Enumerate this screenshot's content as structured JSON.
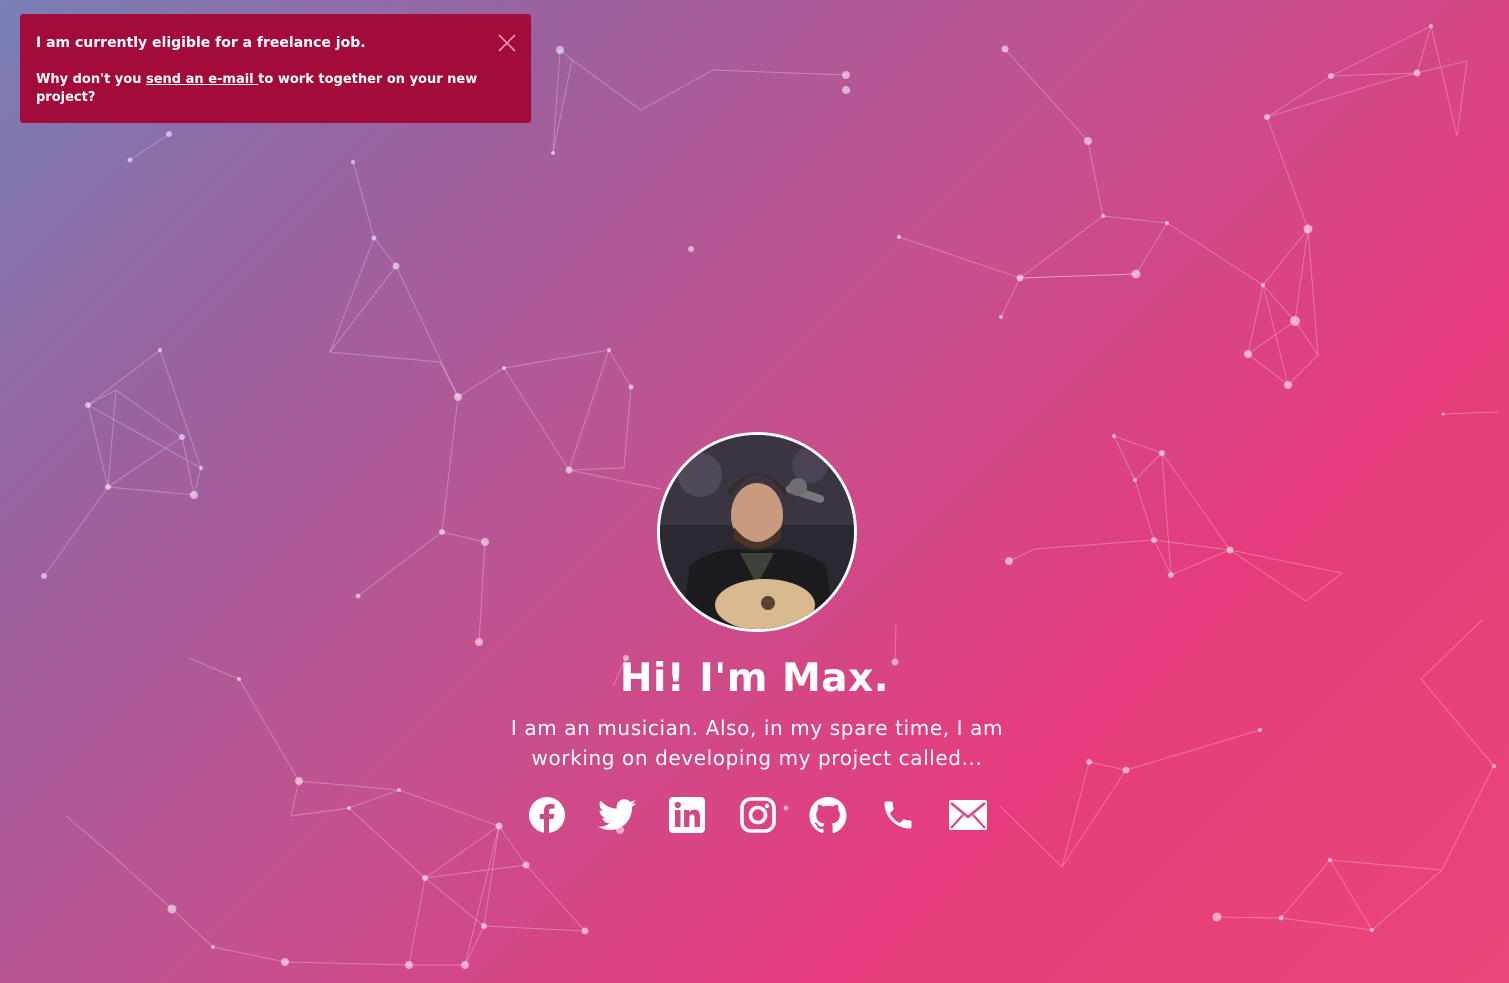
{
  "banner": {
    "title": "I am currently eligible for a freelance job.",
    "text_before": "Why don't you ",
    "link_label": "send an e-mail ",
    "text_after": "to work together on your new project?",
    "close_icon": "close-icon",
    "background": "#a20b3a"
  },
  "hero": {
    "headline": "Hi! I'm Max.",
    "tagline": "I am an musician. Also, in my spare time, I am working on developing my project called..."
  },
  "socials": [
    {
      "name": "facebook",
      "icon": "facebook-icon"
    },
    {
      "name": "twitter",
      "icon": "twitter-icon"
    },
    {
      "name": "linkedin",
      "icon": "linkedin-icon"
    },
    {
      "name": "instagram",
      "icon": "instagram-icon"
    },
    {
      "name": "github",
      "icon": "github-icon"
    },
    {
      "name": "phone",
      "icon": "phone-icon"
    },
    {
      "name": "email",
      "icon": "email-icon"
    }
  ],
  "colors": {
    "gradient_start": "#7880b6",
    "gradient_mid": "#c5508f",
    "gradient_end": "#e63c7d",
    "text": "#ffffff"
  }
}
